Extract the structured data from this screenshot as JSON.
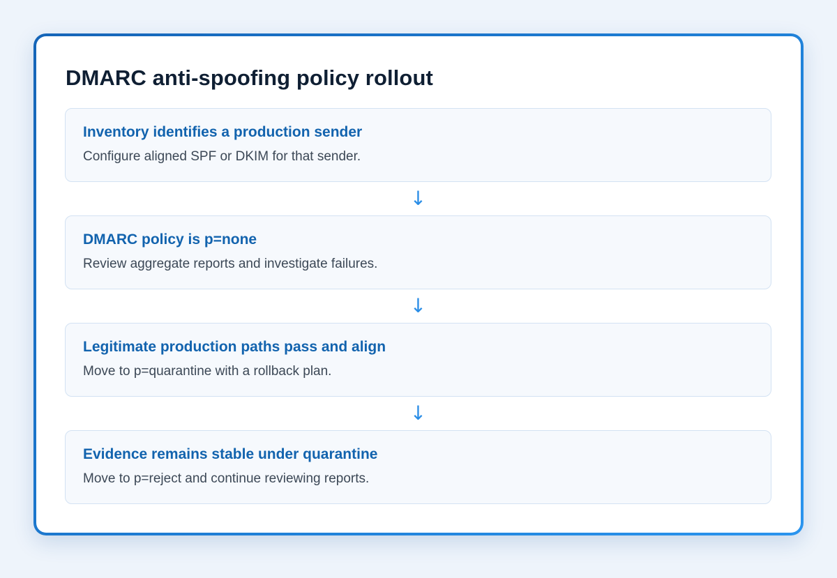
{
  "title": "DMARC anti-spoofing policy rollout",
  "steps": [
    {
      "title": "Inventory identifies a production sender",
      "description": "Configure aligned SPF or DKIM for that sender."
    },
    {
      "title": "DMARC policy is p=none",
      "description": "Review aggregate reports and investigate failures."
    },
    {
      "title": "Legitimate production paths pass and align",
      "description": "Move to p=quarantine with a rollback plan."
    },
    {
      "title": "Evidence remains stable under quarantine",
      "description": "Move to p=reject and continue reviewing reports."
    }
  ],
  "connector": {
    "glyph": "↓",
    "icon": "arrow-down-icon"
  },
  "colors": {
    "frame_start": "#1565b8",
    "frame_end": "#2a94ee",
    "step_title": "#1263ae",
    "arrow": "#2a8de6"
  }
}
